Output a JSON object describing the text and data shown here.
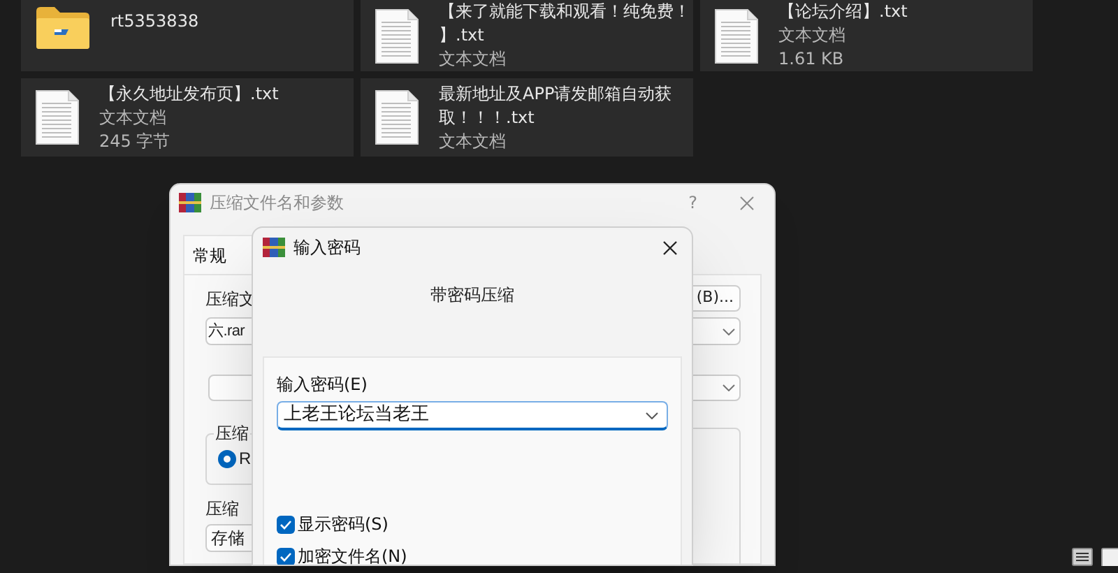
{
  "files": [
    {
      "kind": "folder",
      "name_lines": [
        "rt5353838"
      ]
    },
    {
      "kind": "text",
      "name_lines": [
        "【来了就能下载和观看！纯免费！",
        "】.txt"
      ],
      "details": [
        "文本文档"
      ]
    },
    {
      "kind": "text",
      "name_lines": [
        "【论坛介绍】.txt"
      ],
      "details": [
        "文本文档",
        "1.61 KB"
      ]
    },
    {
      "kind": "text",
      "name_lines": [
        "【永久地址发布页】.txt"
      ],
      "details": [
        "文本文档",
        "245 字节"
      ]
    },
    {
      "kind": "text",
      "name_lines": [
        "最新地址及APP请发邮箱自动获",
        "取！！！.txt"
      ],
      "details": [
        "文本文档"
      ]
    }
  ],
  "archive_dialog": {
    "title": "压缩文件名和参数",
    "help": "?",
    "tabs": [
      {
        "label": "常规",
        "selected": true
      }
    ],
    "archive_label": "压缩文",
    "browse_button": "(B)...",
    "archive_name": "六.rar",
    "format_group": "压缩",
    "format_options": [
      {
        "label": "R",
        "selected": true
      }
    ],
    "method_label": "压缩",
    "method_value": "存储"
  },
  "password_dialog": {
    "title": "输入密码",
    "heading": "带密码压缩",
    "password_label": "输入密码(E)",
    "password": "上老王论坛当老王",
    "options": [
      {
        "label": "显示密码(S)",
        "checked": true
      },
      {
        "label": "加密文件名(N)",
        "checked": true
      }
    ]
  }
}
